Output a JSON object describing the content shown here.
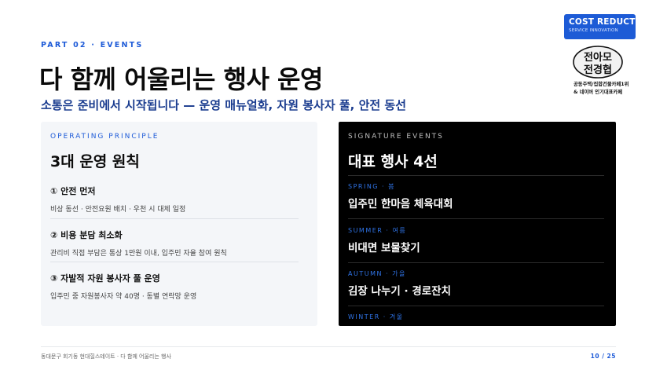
{
  "header": {
    "eyebrow": "PART 02 · EVENTS",
    "title": "다 함께 어울리는 행사 운영",
    "subtitle": "소통은 준비에서 시작됩니다 — 운영 매뉴얼화, 자원 봉사자 풀, 안전 동선"
  },
  "badge": {
    "title": "COST REDUCTI",
    "subtitle": "SERVICE INNOVATION"
  },
  "logo": {
    "text": "전아모 전경협",
    "caption_line1": "공동주택/집합건물카페1위",
    "caption_line2": "& 네이버 인기대표카페"
  },
  "principles": {
    "eyebrow": "OPERATING PRINCIPLE",
    "title": "3대 운영 원칙",
    "items": [
      {
        "heading": "① 안전 먼저",
        "desc": "비상 동선 · 안전요원 배치 · 우천 시 대체 일정"
      },
      {
        "heading": "② 비용 분담 최소화",
        "desc": "관리비 직접 부담은 통상 1만원 이내, 입주민 자율 참여 원칙"
      },
      {
        "heading": "③ 자발적 자원 봉사자 풀 운영",
        "desc": "입주민 중 자원봉사자 약 40명 · 동별 연락망 운영"
      }
    ]
  },
  "events": {
    "eyebrow": "SIGNATURE EVENTS",
    "title": "대표 행사 4선",
    "items": [
      {
        "season": "SPRING · 봄",
        "name": "입주민 한마음 체육대회"
      },
      {
        "season": "SUMMER · 여름",
        "name": "비대면 보물찾기"
      },
      {
        "season": "AUTUMN · 가을",
        "name": "김장 나누기 · 경로잔치"
      },
      {
        "season": "WINTER · 겨울",
        "name": ""
      }
    ]
  },
  "footer": {
    "left": "동대문구 회기동 현대힐스테이트 · 다 함께 어울리는 행사",
    "page": "10 / 25"
  },
  "colors": {
    "accent": "#1e5bd8",
    "navy": "#1a3c8f",
    "dark_card": "#000000",
    "light_card": "#f4f6f9"
  }
}
